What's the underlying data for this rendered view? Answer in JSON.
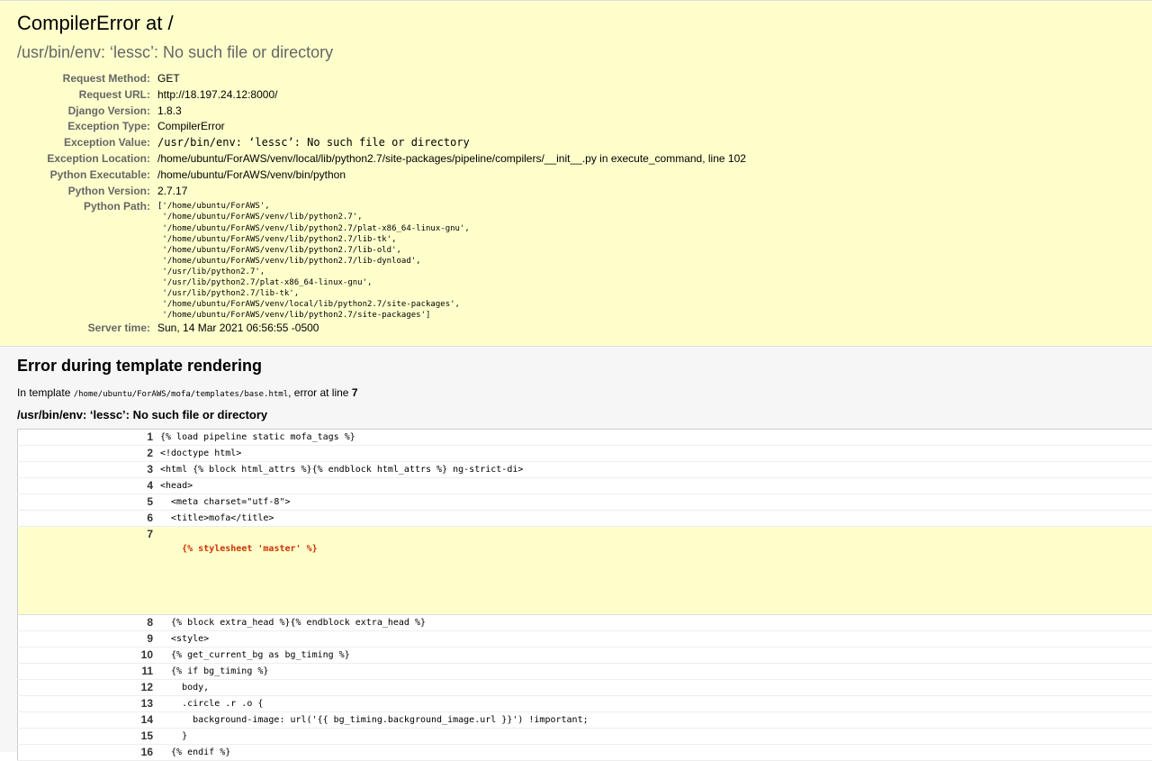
{
  "summary": {
    "title": "CompilerError at /",
    "message": "/usr/bin/env: ‘lessc’: No such file or directory",
    "rows": {
      "request_method": {
        "label": "Request Method:",
        "value": "GET"
      },
      "request_url": {
        "label": "Request URL:",
        "value": "http://18.197.24.12:8000/"
      },
      "django_version": {
        "label": "Django Version:",
        "value": "1.8.3"
      },
      "exception_type": {
        "label": "Exception Type:",
        "value": "CompilerError"
      },
      "exception_value": {
        "label": "Exception Value:",
        "value": "/usr/bin/env: ‘lessc’: No such file or directory"
      },
      "exception_location": {
        "label": "Exception Location:",
        "value": "/home/ubuntu/ForAWS/venv/local/lib/python2.7/site-packages/pipeline/compilers/__init__.py in execute_command, line 102"
      },
      "python_executable": {
        "label": "Python Executable:",
        "value": "/home/ubuntu/ForAWS/venv/bin/python"
      },
      "python_version": {
        "label": "Python Version:",
        "value": "2.7.17"
      },
      "python_path": {
        "label": "Python Path:",
        "value": "['/home/ubuntu/ForAWS',\n '/home/ubuntu/ForAWS/venv/lib/python2.7',\n '/home/ubuntu/ForAWS/venv/lib/python2.7/plat-x86_64-linux-gnu',\n '/home/ubuntu/ForAWS/venv/lib/python2.7/lib-tk',\n '/home/ubuntu/ForAWS/venv/lib/python2.7/lib-old',\n '/home/ubuntu/ForAWS/venv/lib/python2.7/lib-dynload',\n '/usr/lib/python2.7',\n '/usr/lib/python2.7/plat-x86_64-linux-gnu',\n '/usr/lib/python2.7/lib-tk',\n '/home/ubuntu/ForAWS/venv/local/lib/python2.7/site-packages',\n '/home/ubuntu/ForAWS/venv/lib/python2.7/site-packages']"
      },
      "server_time": {
        "label": "Server time:",
        "value": "Sun, 14 Mar 2021 06:56:55 -0500"
      }
    }
  },
  "template": {
    "heading": "Error during template rendering",
    "intro_prefix": "In template ",
    "template_path": "/home/ubuntu/ForAWS/mofa/templates/base.html",
    "intro_suffix": ", error at line ",
    "error_line": "7",
    "error_message": "/usr/bin/env: ‘lessc’: No such file or directory",
    "lines": [
      {
        "num": "1",
        "code": "{% load pipeline static mofa_tags %}"
      },
      {
        "num": "2",
        "code": "<!doctype html>"
      },
      {
        "num": "3",
        "code": "<html {% block html_attrs %}{% endblock html_attrs %} ng-strict-di>"
      },
      {
        "num": "4",
        "code": "<head>"
      },
      {
        "num": "5",
        "code": "  <meta charset=\"utf-8\">"
      },
      {
        "num": "6",
        "code": "  <title>mofa</title>"
      },
      {
        "num": "7",
        "before": "    ",
        "specific": "{% stylesheet 'master' %}"
      },
      {
        "num": "8",
        "code": "  {% block extra_head %}{% endblock extra_head %}"
      },
      {
        "num": "9",
        "code": "  <style>"
      },
      {
        "num": "10",
        "code": "  {% get_current_bg as bg_timing %}"
      },
      {
        "num": "11",
        "code": "  {% if bg_timing %}"
      },
      {
        "num": "12",
        "code": "    body,"
      },
      {
        "num": "13",
        "code": "    .circle .r .o {"
      },
      {
        "num": "14",
        "code": "      background-image: url('{{ bg_timing.background_image.url }}') !important;"
      },
      {
        "num": "15",
        "code": "    }"
      },
      {
        "num": "16",
        "code": "  {% endif %}"
      }
    ]
  }
}
